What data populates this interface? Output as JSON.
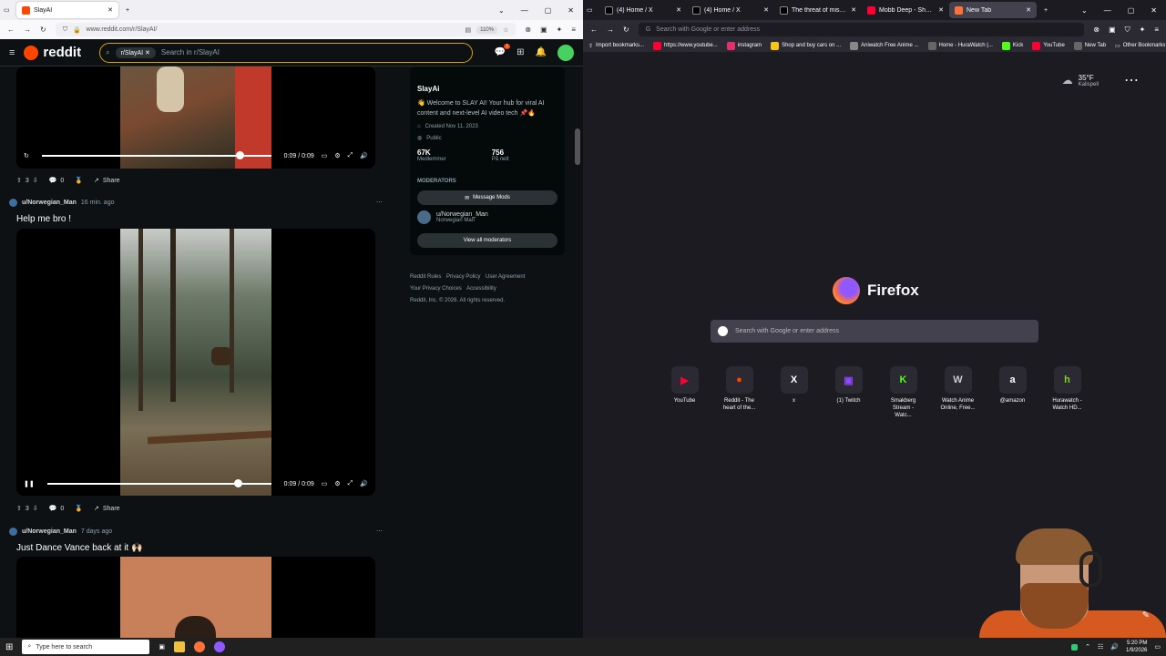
{
  "left_browser": {
    "tabs": [
      {
        "title": "SlayAI",
        "active": true,
        "favicon_color": "#ff4500"
      }
    ],
    "new_tab": "+",
    "url": "www.reddit.com/r/SlayAI/",
    "zoom": "110%"
  },
  "reddit": {
    "logo": "reddit",
    "search_chip": "r/SlayAI",
    "search_placeholder": "Search in r/SlayAI",
    "notification_count": "1",
    "posts": [
      {
        "time_played": "0:09 / 0:09",
        "votes": "3",
        "comments": "0",
        "share": "Share",
        "seek_pct": 100
      },
      {
        "user": "u/Norwegian_Man",
        "time": "16 min. ago",
        "title": "Help me bro !",
        "time_played": "0:09 / 0:09",
        "votes": "3",
        "comments": "0",
        "share": "Share",
        "seek_pct": 100
      },
      {
        "user": "u/Norwegian_Man",
        "time": "7 days ago",
        "title": "Just Dance Vance back at it 🙌🏻"
      }
    ],
    "sidebar": {
      "name": "SlayAi",
      "description": "👋 Welcome to SLAY AI! Your hub for viral AI content and next-level AI video tech 📌🔥",
      "created": "Created Nov 11, 2023",
      "visibility": "Public",
      "members_count": "67K",
      "members_label": "Medlemmer",
      "online_count": "756",
      "online_label": "På nett",
      "moderators_heading": "MODERATORS",
      "message_mods": "Message Mods",
      "mod_name": "u/Norwegian_Man",
      "mod_flair": "Norwegian Man",
      "view_all_mods": "View all moderators",
      "footer_links": [
        "Reddit Rules",
        "Privacy Policy",
        "User Agreement",
        "Your Privacy Choices",
        "Accessibility"
      ],
      "copyright": "Reddit, Inc. © 2026. All rights reserved."
    }
  },
  "right_browser": {
    "tabs": [
      {
        "title": "(4) Home / X",
        "favicon_color": "#000000"
      },
      {
        "title": "(4) Home / X",
        "favicon_color": "#000000"
      },
      {
        "title": "The threat of missile",
        "favicon_color": "#000000"
      },
      {
        "title": "Mobb Deep - Shook Ones",
        "favicon_color": "#ff0033"
      },
      {
        "title": "New Tab",
        "active": true,
        "favicon_color": "#ff7139"
      }
    ],
    "url_placeholder": "Search with Google or enter address",
    "bookmarks": [
      "Import bookmarks...",
      "https://www.youtube...",
      "instagram",
      "Shop and buy cars on ...",
      "Aniwatch Free Anime ...",
      "Home - HuraWatch |...",
      "Kick",
      "YouTube",
      "New Tab"
    ],
    "other_bookmarks": "Other Bookmarks",
    "weather_temp": "35°F",
    "weather_city": "Kalispell",
    "brand": "Firefox",
    "search_placeholder": "Search with Google or enter address",
    "shortcuts": [
      {
        "label": "YouTube",
        "icon": "youtube-icon",
        "color": "#ff0033",
        "glyph": "▶"
      },
      {
        "label": "Reddit - The heart of the...",
        "icon": "reddit-icon",
        "color": "#ff4500",
        "glyph": "●"
      },
      {
        "label": "x",
        "icon": "x-icon",
        "color": "#ffffff",
        "glyph": "X"
      },
      {
        "label": "(1) Twitch",
        "icon": "twitch-icon",
        "color": "#9146ff",
        "glyph": "▣"
      },
      {
        "label": "Smakberg Stream - Watc...",
        "icon": "kick-icon",
        "color": "#53fc18",
        "glyph": "K"
      },
      {
        "label": "Watch Anime Online, Free...",
        "icon": "aniwatch-icon",
        "color": "#cccccc",
        "glyph": "W"
      },
      {
        "label": "@amazon",
        "icon": "amazon-icon",
        "color": "#ffffff",
        "glyph": "a"
      },
      {
        "label": "Hurawatch - Watch HD...",
        "icon": "hurawatch-icon",
        "color": "#7ed321",
        "glyph": "h"
      }
    ]
  },
  "taskbar": {
    "search_placeholder": "Type here to search",
    "time": "5:20 PM",
    "date": "1/9/2026"
  }
}
